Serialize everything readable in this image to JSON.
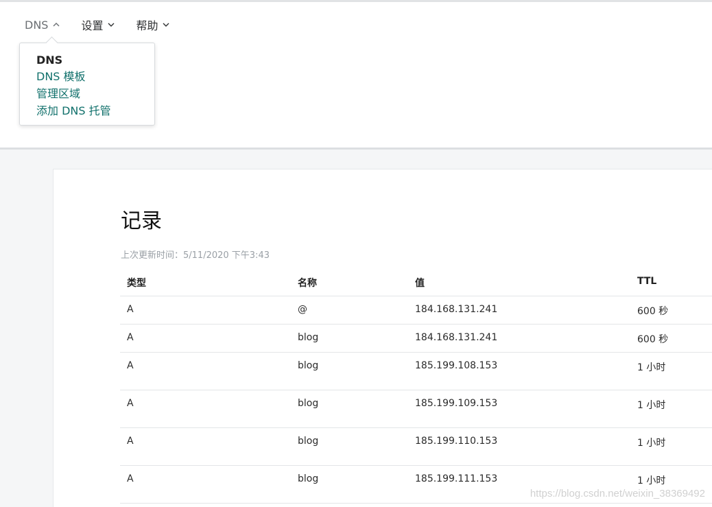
{
  "nav": {
    "items": [
      {
        "label": "DNS",
        "active": true
      },
      {
        "label": "设置",
        "active": false
      },
      {
        "label": "帮助",
        "active": false
      }
    ]
  },
  "dropdown": {
    "title": "DNS",
    "links": [
      "DNS 模板",
      "管理区域",
      "添加 DNS 托管"
    ]
  },
  "records": {
    "title": "记录",
    "updated": "上次更新时间：5/11/2020 下午3:43",
    "columns": [
      "类型",
      "名称",
      "值",
      "TTL"
    ],
    "rows": [
      [
        "A",
        "@",
        "184.168.131.241",
        "600 秒"
      ],
      [
        "A",
        "blog",
        "184.168.131.241",
        "600 秒"
      ],
      [
        "A",
        "blog",
        "185.199.108.153",
        "1 小时"
      ],
      [
        "A",
        "blog",
        "185.199.109.153",
        "1 小时"
      ],
      [
        "A",
        "blog",
        "185.199.110.153",
        "1 小时"
      ],
      [
        "A",
        "blog",
        "185.199.111.153",
        "1 小时"
      ]
    ]
  },
  "watermark": "https://blog.csdn.net/weixin_38369492",
  "colors": {
    "link": "#10706b",
    "background": "#f5f6f7"
  }
}
